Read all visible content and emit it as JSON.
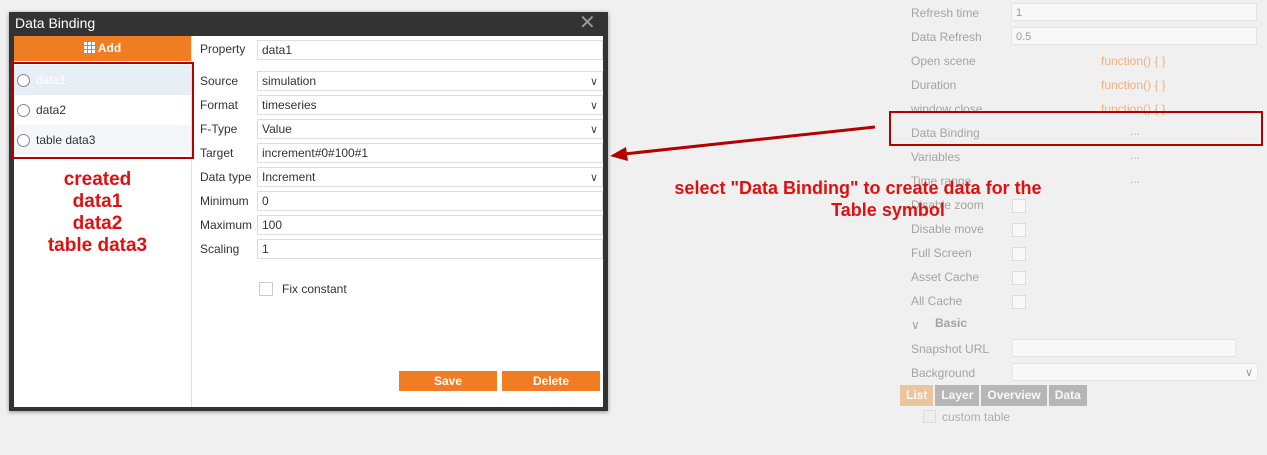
{
  "dialog": {
    "title": "Data Binding",
    "close_glyph": "✕",
    "add_label": "Add",
    "items": [
      {
        "label": "data1"
      },
      {
        "label": "data2"
      },
      {
        "label": "table data3"
      }
    ],
    "form": {
      "property": {
        "label": "Property",
        "value": "data1"
      },
      "source": {
        "label": "Source",
        "value": "simulation"
      },
      "format": {
        "label": "Format",
        "value": "timeseries"
      },
      "ftype": {
        "label": "F-Type",
        "value": "Value"
      },
      "target": {
        "label": "Target",
        "value": "increment#0#100#1"
      },
      "datatype": {
        "label": "Data type",
        "value": "Increment"
      },
      "minimum": {
        "label": "Minimum",
        "value": "0"
      },
      "maximum": {
        "label": "Maximum",
        "value": "100"
      },
      "scaling": {
        "label": "Scaling",
        "value": "1"
      },
      "fix_constant": {
        "label": "Fix constant",
        "checked": false
      }
    },
    "save_label": "Save",
    "delete_label": "Delete"
  },
  "annotations": {
    "created_lines": [
      "created",
      "data1",
      "data2",
      "table data3"
    ],
    "callout_line1": "select \"Data Binding\" to create data for the",
    "callout_line2": "Table symbol",
    "color": "#e01010"
  },
  "panel": {
    "refresh_time": {
      "label": "Refresh time",
      "value": "1"
    },
    "data_refresh": {
      "label": "Data Refresh",
      "value": "0.5"
    },
    "open_scene": {
      "label": "Open scene",
      "value": "function() {  }"
    },
    "duration": {
      "label": "Duration",
      "value": "function() {  }"
    },
    "window_close": {
      "label": "window close",
      "value": "function() {  }"
    },
    "data_binding": {
      "label": "Data Binding",
      "value": "..."
    },
    "variables": {
      "label": "Variables",
      "value": "..."
    },
    "time_range": {
      "label": "Time range",
      "value": "..."
    },
    "disable_zoom": {
      "label": "Disable zoom"
    },
    "disable_move": {
      "label": "Disable move"
    },
    "full_screen": {
      "label": "Full Screen"
    },
    "asset_cache": {
      "label": "Asset Cache"
    },
    "all_cache": {
      "label": "All Cache"
    },
    "basic_section": "Basic",
    "snapshot_url": {
      "label": "Snapshot URL",
      "value": ""
    },
    "background": {
      "label": "Background",
      "value": ""
    },
    "tabs": [
      "List",
      "Layer",
      "Overview",
      "Data"
    ],
    "tree_item": "custom table"
  },
  "colors": {
    "accent": "#f07d22",
    "title_bar": "#333333",
    "highlight": "#b30000"
  }
}
